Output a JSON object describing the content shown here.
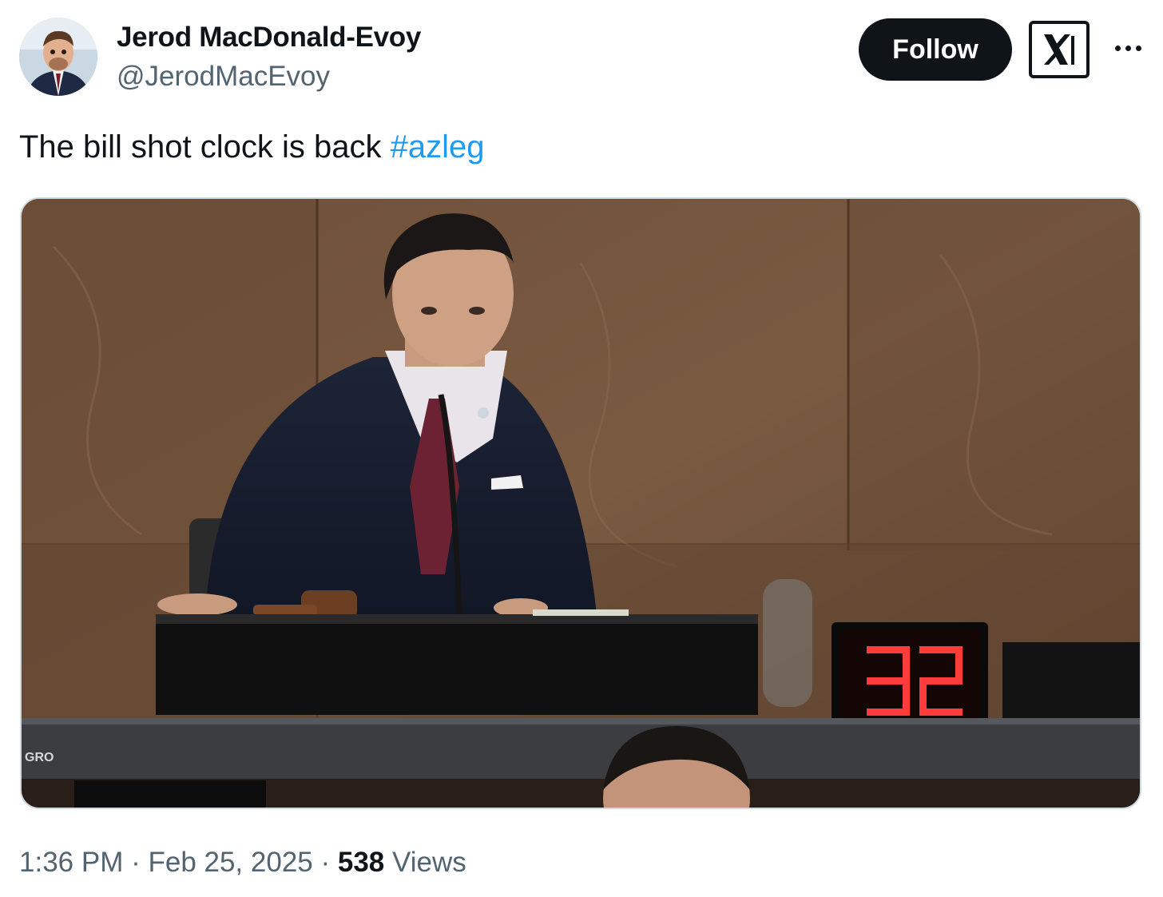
{
  "author": {
    "name": "Jerod MacDonald-Evoy",
    "handle": "@JerodMacEvoy"
  },
  "actions": {
    "follow_label": "Follow",
    "logo_icon": "x-logo-icon",
    "more_icon": "more-dots-icon"
  },
  "tweet": {
    "text": "The bill shot clock is back ",
    "hashtag": "#azleg"
  },
  "media": {
    "clock_digits": "32",
    "plaque_text": "GRO"
  },
  "meta": {
    "time": "1:36 PM",
    "sep1": " · ",
    "date": "Feb 25, 2025",
    "sep2": " · ",
    "views_count": "538",
    "views_label": " Views"
  },
  "colors": {
    "text": "#0f1419",
    "secondary": "#536471",
    "link": "#1d9bf0",
    "clock_led": "#ff3b3b"
  }
}
